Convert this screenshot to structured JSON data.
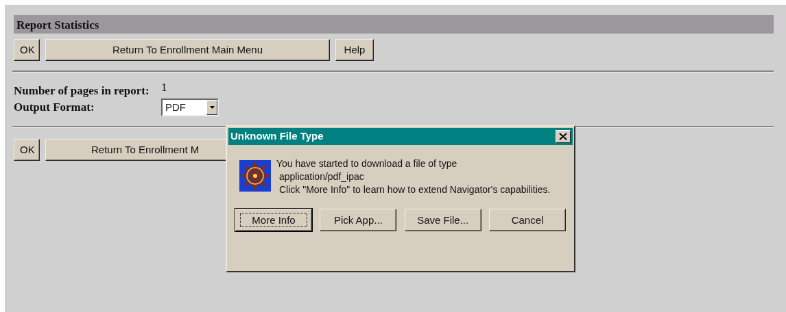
{
  "page": {
    "title": "Report Statistics",
    "top_buttons": [
      "OK",
      "Return To Enrollment Main Menu",
      "Help"
    ],
    "fields": [
      {
        "label": "Number of pages in report:",
        "kind": "text",
        "value": "1"
      },
      {
        "label": "Output Format:",
        "kind": "select",
        "value": "PDF"
      }
    ],
    "bottom_buttons": [
      "OK",
      "Return To Enrollment M"
    ]
  },
  "dialog": {
    "title": "Unknown File Type",
    "message_lines": [
      "You have started to download a file of type",
      "application/pdf_ipac",
      "Click \"More Info\" to learn how to extend Navigator's capabilities."
    ],
    "buttons": [
      {
        "label": "More Info",
        "default": true
      },
      {
        "label": "Pick App...",
        "default": false
      },
      {
        "label": "Save File...",
        "default": false
      },
      {
        "label": "Cancel",
        "default": false
      }
    ]
  }
}
